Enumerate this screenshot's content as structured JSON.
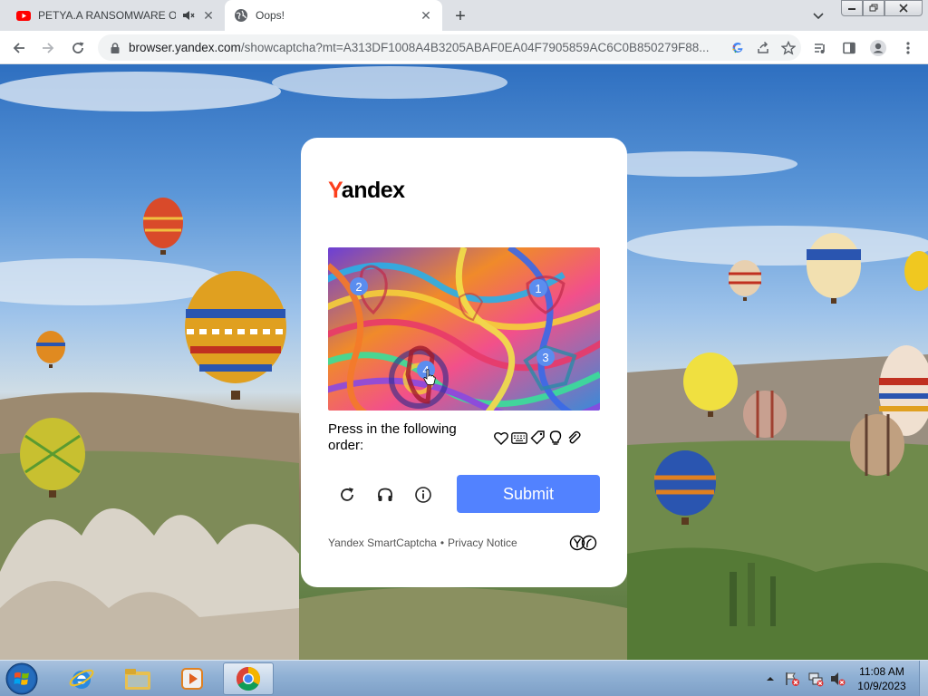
{
  "browser": {
    "tabs": [
      {
        "label": "PETYA.A RANSOMWARE ON",
        "icon": "youtube-icon",
        "state": "inactive",
        "muted": true
      },
      {
        "label": "Oops!",
        "icon": "globe-icon",
        "state": "active"
      }
    ],
    "address": {
      "host": "browser.yandex.com",
      "path": "/showcaptcha?mt=A313DF1008A4B3205ABAF0EA04F7905859AC6C0B850279F88..."
    }
  },
  "captcha": {
    "logo_first": "Y",
    "logo_rest": "andex",
    "instruction": "Press in the following order:",
    "submit_label": "Submit",
    "footer_brand": "Yandex SmartCaptcha",
    "footer_separator": "•",
    "footer_privacy": "Privacy Notice",
    "click_markers": [
      "1",
      "2",
      "3",
      "4"
    ],
    "order_icons": [
      "heart-outline-icon",
      "keyboard-icon",
      "price-tag-icon",
      "lightbulb-icon",
      "paperclip-icon"
    ],
    "submit_color": "#5282ff"
  },
  "taskbar": {
    "time": "11:08 AM",
    "date": "10/9/2023"
  },
  "colors": {
    "yandex_red": "#fc3f1d",
    "tabstrip": "#dee1e6"
  }
}
